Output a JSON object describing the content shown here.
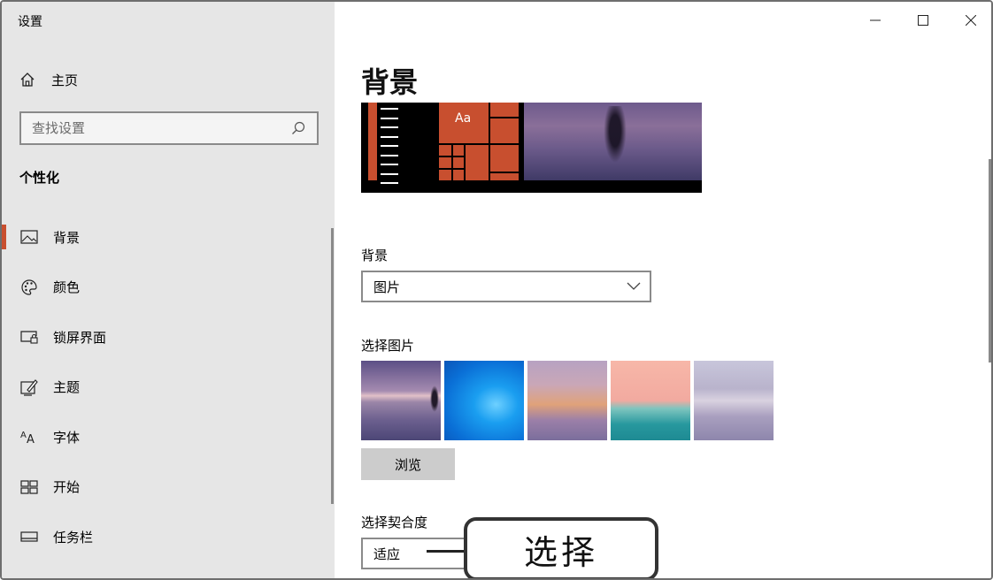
{
  "window": {
    "title": "设置"
  },
  "sidebar": {
    "home_label": "主页",
    "search_placeholder": "查找设置",
    "section_title": "个性化",
    "items": [
      {
        "label": "背景",
        "icon": "picture-icon",
        "active": true
      },
      {
        "label": "颜色",
        "icon": "palette-icon",
        "active": false
      },
      {
        "label": "锁屏界面",
        "icon": "lock-screen-icon",
        "active": false
      },
      {
        "label": "主题",
        "icon": "theme-icon",
        "active": false
      },
      {
        "label": "字体",
        "icon": "font-icon",
        "active": false
      },
      {
        "label": "开始",
        "icon": "start-icon",
        "active": false
      },
      {
        "label": "任务栏",
        "icon": "taskbar-icon",
        "active": false
      }
    ]
  },
  "main": {
    "page_title": "背景",
    "preview": {
      "tile_label": "Aa"
    },
    "background_label": "背景",
    "background_value": "图片",
    "choose_picture_label": "选择图片",
    "browse_button": "浏览",
    "fit_label": "选择契合度",
    "fit_value": "适应"
  },
  "annotation": {
    "text": "选择"
  },
  "colors": {
    "accent": "#c84f2f",
    "sidebar_bg": "#e6e6e6"
  }
}
